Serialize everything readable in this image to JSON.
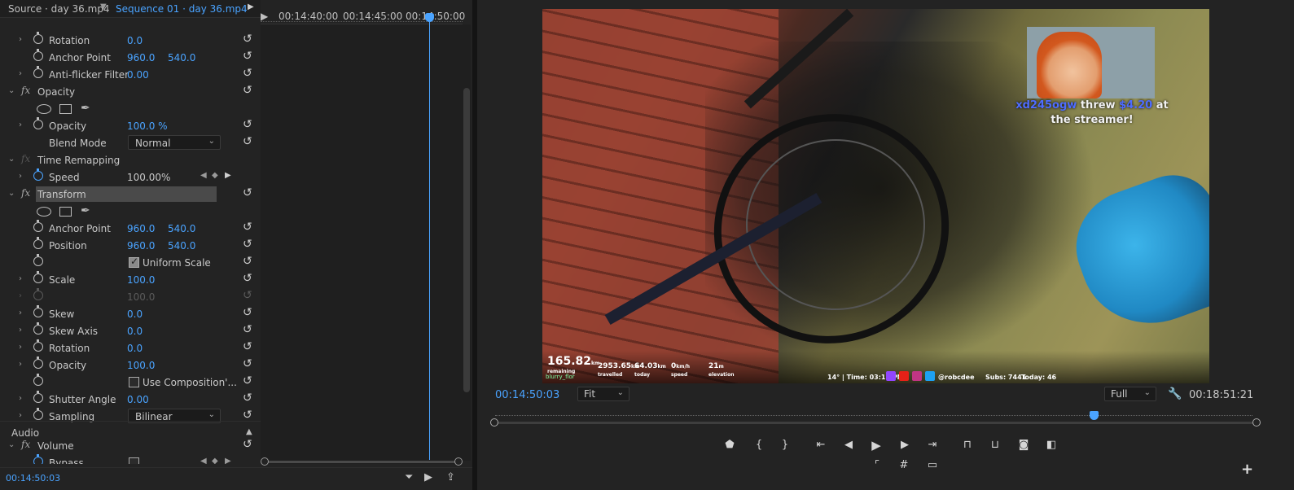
{
  "effect_controls": {
    "tabs": {
      "source": "Source · day 36.mp4",
      "sequence": "Sequence 01 · day 36.mp4"
    },
    "ruler": [
      "00:14:40:00",
      "00:14:45:00",
      "00:14:50:00"
    ],
    "rows": {
      "rotation": {
        "label": "Rotation",
        "value": "0.0"
      },
      "anchor_point": {
        "label": "Anchor Point",
        "x": "960.0",
        "y": "540.0"
      },
      "anti_flicker": {
        "label": "Anti-flicker Filter",
        "value": "0.00"
      },
      "opacity_section": {
        "label": "Opacity"
      },
      "opacity": {
        "label": "Opacity",
        "value": "100.0 %"
      },
      "blend_mode": {
        "label": "Blend Mode",
        "value": "Normal"
      },
      "time_remapping": {
        "label": "Time Remapping"
      },
      "speed": {
        "label": "Speed",
        "value": "100.00%"
      },
      "transform_section": {
        "label": "Transform"
      },
      "t_anchor_point": {
        "label": "Anchor Point",
        "x": "960.0",
        "y": "540.0"
      },
      "t_position": {
        "label": "Position",
        "x": "960.0",
        "y": "540.0"
      },
      "t_uniform_scale": {
        "label": "Uniform Scale",
        "checked": true
      },
      "t_scale": {
        "label": "Scale",
        "value": "100.0"
      },
      "t_scale_width": {
        "value": "100.0"
      },
      "t_skew": {
        "label": "Skew",
        "value": "0.0"
      },
      "t_skew_axis": {
        "label": "Skew Axis",
        "value": "0.0"
      },
      "t_rotation": {
        "label": "Rotation",
        "value": "0.0"
      },
      "t_opacity": {
        "label": "Opacity",
        "value": "100.0"
      },
      "t_use_comp": {
        "label": "Use Composition'..."
      },
      "t_shutter": {
        "label": "Shutter Angle",
        "value": "0.00"
      },
      "t_sampling": {
        "label": "Sampling",
        "value": "Bilinear"
      },
      "audio": {
        "label": "Audio"
      },
      "volume": {
        "label": "Volume"
      },
      "bypass": {
        "label": "Bypass"
      }
    },
    "footer_timecode": "00:14:50:03"
  },
  "program_monitor": {
    "timecode": "00:14:50:03",
    "zoom": "Fit",
    "quality": "Full",
    "duration": "00:18:51:21",
    "overlay": {
      "donation_user": "xd245ogw",
      "donation_text": "threw",
      "donation_amount": "$4.20",
      "donation_tail": "at the streamer!",
      "stats": [
        {
          "n": "165.82",
          "u": "km",
          "s": "remaining"
        },
        {
          "n": "2953.65",
          "u": "km",
          "s": "travelled"
        },
        {
          "n": "64.03",
          "u": "km",
          "s": "today"
        },
        {
          "n": "0",
          "u": "km/h",
          "s": "speed"
        },
        {
          "n": "21",
          "u": "m",
          "s": "elevation"
        }
      ],
      "username": "blurry_flor",
      "right_info": "14° | Time: 03:18 PM",
      "handle": "@robcdee",
      "subs": "Subs: 7441",
      "today": "Today: 46"
    }
  }
}
